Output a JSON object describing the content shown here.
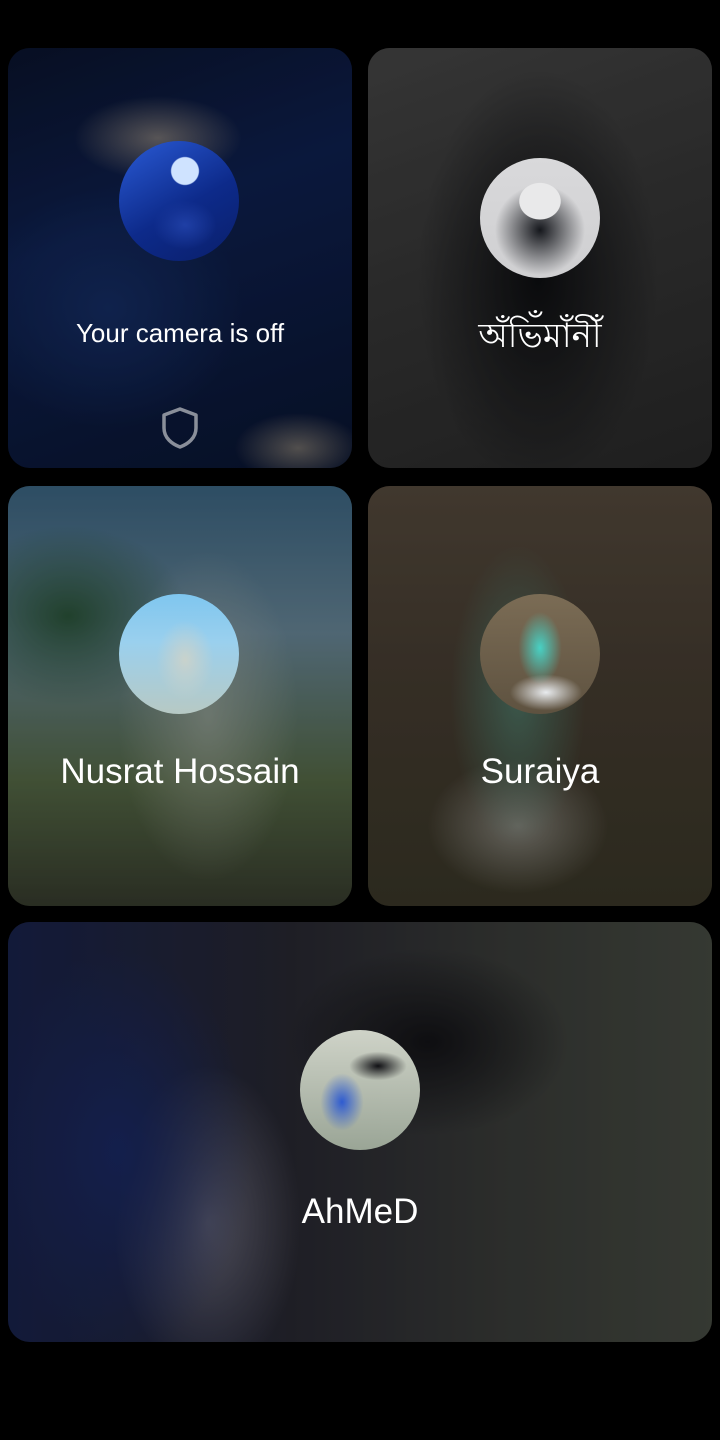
{
  "participants": [
    {
      "label": "Your camera is off",
      "avatar_icon": "avatar-photo",
      "status_icon": "shield-icon"
    },
    {
      "label": "অঁভিঁমাঁনীঁ",
      "avatar_icon": "avatar-photo"
    },
    {
      "label": "Nusrat Hossain",
      "avatar_icon": "avatar-photo"
    },
    {
      "label": "Suraiya",
      "avatar_icon": "avatar-photo"
    },
    {
      "label": "AhMeD",
      "avatar_icon": "avatar-photo"
    }
  ],
  "colors": {
    "background": "#000000",
    "label_text": "#ffffff",
    "shield_stroke": "#8a8f9a"
  }
}
